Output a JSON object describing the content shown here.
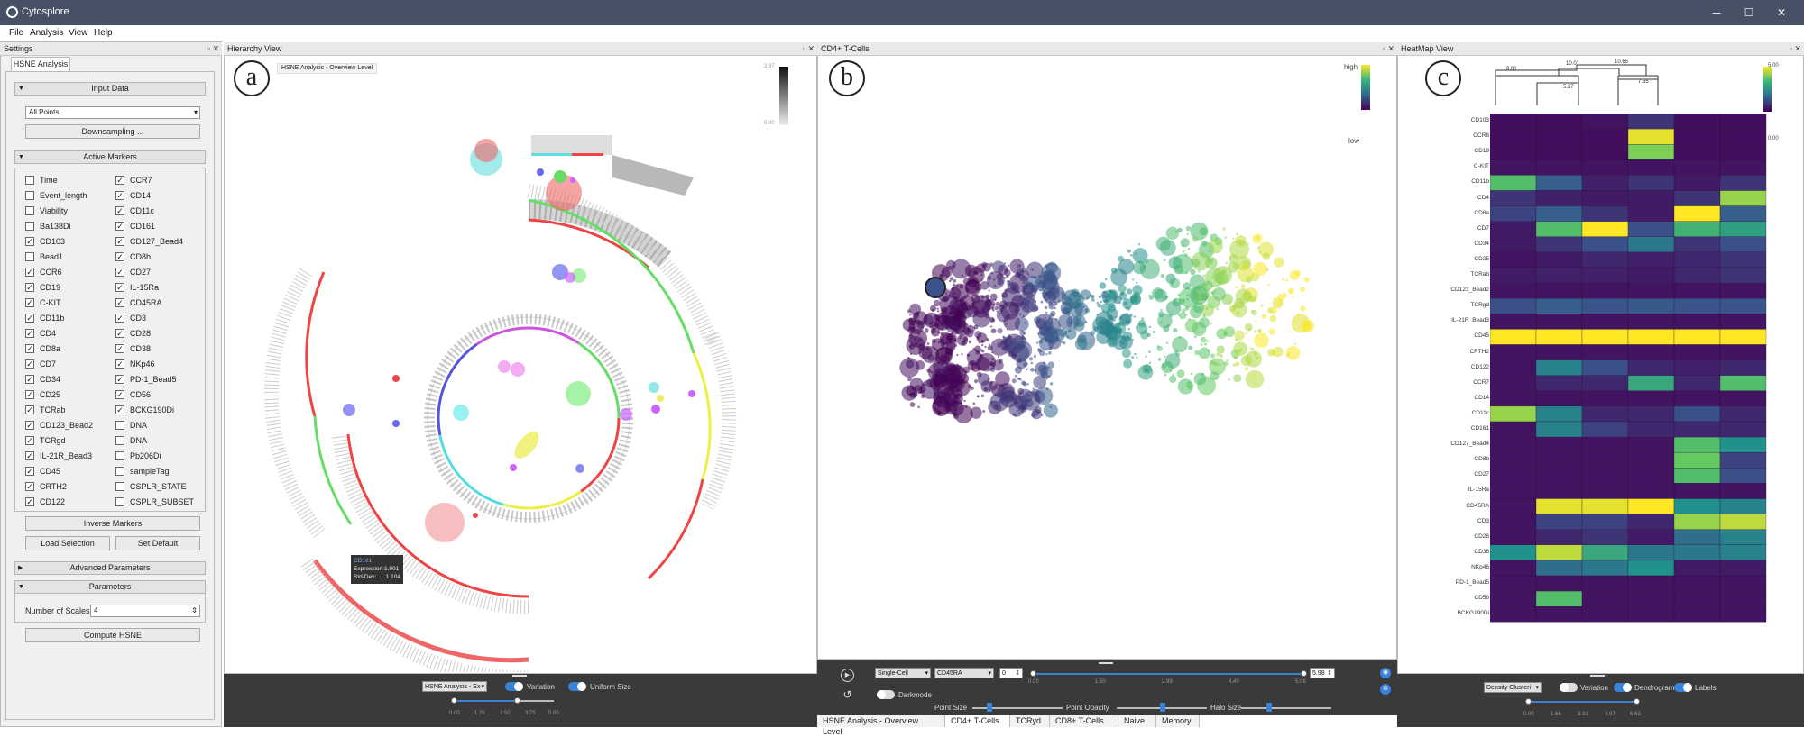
{
  "window": {
    "title": "Cytosplore"
  },
  "menu": [
    "File",
    "Analysis",
    "View",
    "Help"
  ],
  "settings": {
    "title": "Settings",
    "tab": "HSNE Analysis",
    "input_data": "Input Data",
    "all_points": "All Points",
    "downsampling": "Downsampling ...",
    "active_markers": "Active Markers",
    "markers_left": [
      {
        "label": "Time",
        "checked": false
      },
      {
        "label": "Event_length",
        "checked": false
      },
      {
        "label": "Viability",
        "checked": false
      },
      {
        "label": "Ba138Di",
        "checked": false
      },
      {
        "label": "CD103",
        "checked": true
      },
      {
        "label": "Bead1",
        "checked": false
      },
      {
        "label": "CCR6",
        "checked": true
      },
      {
        "label": "CD19",
        "checked": true
      },
      {
        "label": "C-KIT",
        "checked": true
      },
      {
        "label": "CD11b",
        "checked": true
      },
      {
        "label": "CD4",
        "checked": true
      },
      {
        "label": "CD8a",
        "checked": true
      },
      {
        "label": "CD7",
        "checked": true
      },
      {
        "label": "CD34",
        "checked": true
      },
      {
        "label": "CD25",
        "checked": true
      },
      {
        "label": "TCRab",
        "checked": true
      },
      {
        "label": "CD123_Bead2",
        "checked": true
      },
      {
        "label": "TCRgd",
        "checked": true
      },
      {
        "label": "IL-21R_Bead3",
        "checked": true
      },
      {
        "label": "CD45",
        "checked": true
      },
      {
        "label": "CRTH2",
        "checked": true
      },
      {
        "label": "CD122",
        "checked": true
      }
    ],
    "markers_right": [
      {
        "label": "CCR7",
        "checked": true
      },
      {
        "label": "CD14",
        "checked": true
      },
      {
        "label": "CD11c",
        "checked": true
      },
      {
        "label": "CD161",
        "checked": true
      },
      {
        "label": "CD127_Bead4",
        "checked": true
      },
      {
        "label": "CD8b",
        "checked": true
      },
      {
        "label": "CD27",
        "checked": true
      },
      {
        "label": "IL-15Ra",
        "checked": true
      },
      {
        "label": "CD45RA",
        "checked": true
      },
      {
        "label": "CD3",
        "checked": true
      },
      {
        "label": "CD28",
        "checked": true
      },
      {
        "label": "CD38",
        "checked": true
      },
      {
        "label": "NKp46",
        "checked": true
      },
      {
        "label": "PD-1_Bead5",
        "checked": true
      },
      {
        "label": "CD56",
        "checked": true
      },
      {
        "label": "BCKG190Di",
        "checked": true
      },
      {
        "label": "DNA",
        "checked": false
      },
      {
        "label": "DNA",
        "checked": false
      },
      {
        "label": "Pb206Di",
        "checked": false
      },
      {
        "label": "sampleTag",
        "checked": false
      },
      {
        "label": "CSPLR_STATE",
        "checked": false
      },
      {
        "label": "CSPLR_SUBSET",
        "checked": false
      }
    ],
    "inverse_markers": "Inverse Markers",
    "load_selection": "Load Selection",
    "set_default": "Set Default",
    "advanced_parameters": "Advanced Parameters",
    "parameters": "Parameters",
    "number_of_scales_label": "Number of Scales",
    "number_of_scales": "4",
    "compute": "Compute HSNE"
  },
  "hierarchy": {
    "title": "Hierarchy View",
    "letter": "a",
    "breadcrumb": "HSNE Analysis - Overview Level",
    "scale_max": "2.97",
    "scale_min": "0.00",
    "tooltip": {
      "name": "CD161",
      "expression": "Expression:1.901",
      "stddev": "Std-Dev:",
      "stddev_val": "1.104"
    },
    "footer": {
      "select": "HSNE Analysis - Ex",
      "variation": "Variation",
      "uniform": "Uniform Size",
      "ticks": [
        "0.00",
        "1.25",
        "2.50",
        "3.75",
        "5.00"
      ]
    }
  },
  "cd4": {
    "title": "CD4+ T-Cells",
    "letter": "b",
    "legend_high": "high",
    "legend_low": "low",
    "footer": {
      "mode": "Single-Cell",
      "marker": "CD45RA",
      "min": "0",
      "max": "5.98",
      "ticks": [
        "0.00",
        "1.50",
        "2.99",
        "4.49",
        "5.98"
      ],
      "darkmode": "Darkmode",
      "point_size": "Point Size",
      "point_opacity": "Point Opacity",
      "halo_size": "Halo Size"
    }
  },
  "heatmap": {
    "title": "HeatMap View",
    "letter": "c",
    "scale_max": "5.00",
    "scale_min": "0.00",
    "dendrogram": [
      "9.81",
      "10.01",
      "10.65",
      "5.37",
      "7.55"
    ],
    "footer": {
      "select": "Density Clusteri",
      "variation": "Variation",
      "dendrogram": "Dendrogram",
      "labels": "Labels",
      "ticks": [
        "0.00",
        "1.66",
        "3.31",
        "4.97",
        "6.63"
      ]
    },
    "rows": [
      "CD103",
      "CCR6",
      "CD19",
      "C-KIT",
      "CD11b",
      "CD4",
      "CD8a",
      "CD7",
      "CD34",
      "CD25",
      "TCRab",
      "CD123_Bead2",
      "TCRgd",
      "IL-21R_Bead3",
      "CD45",
      "CRTH2",
      "CD122",
      "CCR7",
      "CD14",
      "CD11c",
      "CD161",
      "CD127_Bead4",
      "CD8b",
      "CD27",
      "IL-15Ra",
      "CD45RA",
      "CD3",
      "CD28",
      "CD38",
      "NKp46",
      "PD-1_Bead5",
      "CD56",
      "BCKG190Di"
    ],
    "values": [
      [
        0.2,
        0.2,
        0.3,
        0.8,
        0.2,
        0.2
      ],
      [
        0.2,
        0.2,
        0.2,
        4.8,
        0.2,
        0.2
      ],
      [
        0.2,
        0.2,
        0.2,
        4.0,
        0.2,
        0.2
      ],
      [
        0.3,
        0.3,
        0.3,
        0.3,
        0.3,
        0.3
      ],
      [
        3.5,
        1.5,
        0.5,
        0.8,
        0.4,
        0.8
      ],
      [
        0.8,
        0.5,
        0.4,
        0.4,
        0.8,
        4.2
      ],
      [
        1.0,
        1.5,
        0.8,
        0.4,
        5.0,
        1.5
      ],
      [
        0.4,
        3.5,
        5.0,
        1.2,
        3.2,
        2.8
      ],
      [
        0.4,
        0.8,
        1.2,
        2.0,
        0.8,
        1.2
      ],
      [
        0.3,
        0.4,
        0.6,
        0.5,
        0.6,
        0.8
      ],
      [
        0.4,
        0.5,
        0.5,
        0.4,
        0.6,
        0.8
      ],
      [
        0.3,
        0.3,
        0.3,
        0.3,
        0.3,
        0.3
      ],
      [
        1.2,
        1.5,
        1.3,
        1.4,
        1.3,
        1.3
      ],
      [
        0.3,
        0.3,
        0.3,
        0.3,
        0.3,
        0.3
      ],
      [
        5.0,
        5.0,
        5.0,
        5.0,
        5.0,
        5.0
      ],
      [
        0.3,
        0.3,
        0.3,
        0.3,
        0.3,
        0.3
      ],
      [
        0.3,
        2.2,
        1.2,
        0.6,
        0.5,
        0.6
      ],
      [
        0.3,
        0.6,
        0.6,
        3.0,
        0.6,
        3.5
      ],
      [
        0.3,
        0.3,
        0.3,
        0.3,
        0.3,
        0.3
      ],
      [
        4.2,
        2.2,
        0.6,
        0.6,
        1.2,
        0.6
      ],
      [
        0.3,
        2.2,
        1.0,
        0.6,
        0.6,
        0.6
      ],
      [
        0.3,
        0.3,
        0.3,
        0.3,
        3.5,
        2.5
      ],
      [
        0.3,
        0.3,
        0.3,
        0.3,
        3.8,
        1.0
      ],
      [
        0.3,
        0.3,
        0.3,
        0.3,
        3.5,
        1.2
      ],
      [
        0.3,
        0.3,
        0.3,
        0.3,
        0.3,
        0.3
      ],
      [
        0.3,
        4.8,
        4.8,
        5.0,
        2.5,
        2.2
      ],
      [
        0.3,
        1.0,
        1.0,
        0.6,
        4.2,
        4.5
      ],
      [
        0.3,
        0.6,
        0.8,
        0.4,
        1.8,
        2.2
      ],
      [
        2.5,
        4.5,
        3.0,
        2.0,
        2.0,
        2.2
      ],
      [
        0.3,
        1.8,
        2.0,
        2.5,
        0.4,
        0.4
      ],
      [
        0.3,
        0.3,
        0.3,
        0.3,
        0.3,
        0.3
      ],
      [
        0.3,
        3.5,
        0.3,
        0.3,
        0.3,
        0.3
      ],
      [
        0.3,
        0.3,
        0.3,
        0.3,
        0.3,
        0.3
      ]
    ]
  },
  "bottom_tabs": [
    {
      "label": "HSNE Analysis - Overview Level",
      "active": false
    },
    {
      "label": "CD4+ T-Cells",
      "active": true
    },
    {
      "label": "TCRyd",
      "active": false
    },
    {
      "label": "CD8+ T-Cells",
      "active": false
    },
    {
      "label": "Naive",
      "active": false
    },
    {
      "label": "Memory",
      "active": false
    }
  ]
}
